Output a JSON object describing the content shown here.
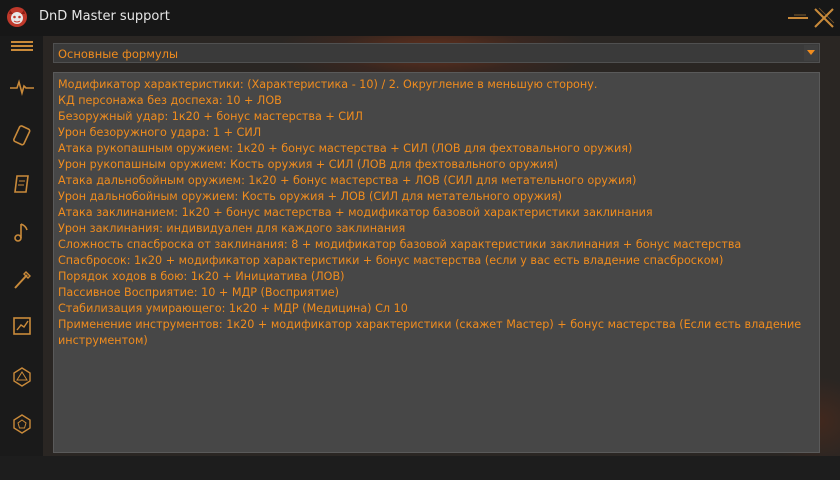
{
  "window": {
    "title": "DnD Master support",
    "logo_icon": "red-dragon-icon",
    "minimize_icon": "minimize-icon",
    "close_icon": "close-icon"
  },
  "sidebar": {
    "items": [
      {
        "icon": "menu-icon"
      },
      {
        "icon": "pulse-icon"
      },
      {
        "icon": "card-icon"
      },
      {
        "icon": "scroll-icon"
      },
      {
        "icon": "music-note-icon"
      },
      {
        "icon": "wand-icon"
      },
      {
        "icon": "chart-icon"
      },
      {
        "icon": "d20-icon"
      },
      {
        "icon": "d12-icon"
      }
    ]
  },
  "dropdown": {
    "selected": "Основные формулы"
  },
  "content": {
    "lines": [
      "Модификатор характеристики: (Характеристика - 10) / 2. Округление в меньшую сторону.",
      "КД персонажа без доспеха: 10 + ЛОВ",
      "Безоружный удар: 1к20 + бонус мастерства + СИЛ",
      "Урон безоружного удара: 1 + СИЛ",
      "Атака рукопашным оружием: 1к20 + бонус мастерства + СИЛ (ЛОВ для фехтовального оружия)",
      "Урон рукопашным оружием: Кость оружия + СИЛ (ЛОВ для фехтовального оружия)",
      "Атака дальнобойным оружием: 1к20 + бонус мастерства + ЛОВ (СИЛ для метательного оружия)",
      "Урон дальнобойным оружием: Кость оружия + ЛОВ (СИЛ для метательного оружия)",
      "Атака заклинанием: 1к20 + бонус мастерства + модификатор базовой характеристики заклинания",
      "Урон заклинания: индивидуален для каждого заклинания",
      "Сложность спасброска от заклинания: 8 + модификатор базовой характеристики заклинания + бонус мастерства",
      "Спасбросок: 1к20 + модификатор характеристики + бонус мастерства (если у вас есть владение спасброском)",
      "Порядок ходов в бою: 1к20 + Инициатива (ЛОВ)",
      "Пассивное Восприятие: 10 + МДР (Восприятие)",
      "Стабилизация умирающего: 1к20 + МДР (Медицина) Сл 10",
      "Применение инструментов: 1к20 + модификатор характеристики (скажет Мастер) + бонус мастерства (Если есть владение инструментом)"
    ]
  },
  "colors": {
    "accent": "#f08c1e",
    "icon": "#c98a3a",
    "titlebar_bg": "#171717",
    "panel_bg": "#474747"
  }
}
